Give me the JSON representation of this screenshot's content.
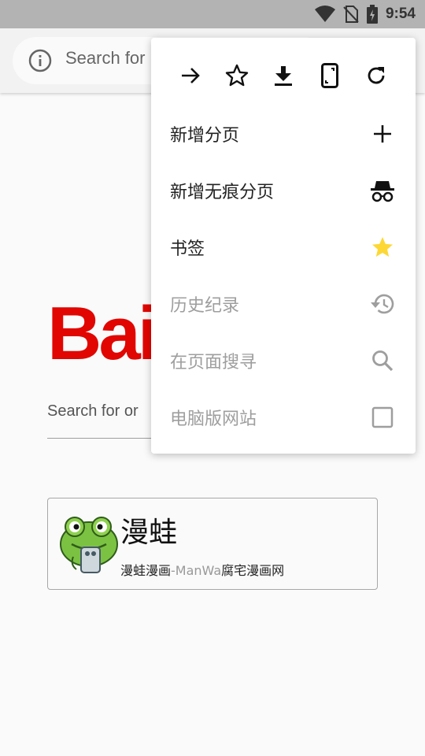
{
  "status_bar": {
    "time": "9:54",
    "icons": [
      "wifi-icon",
      "no-sim-icon",
      "battery-charging-icon"
    ]
  },
  "toolbar": {
    "url_placeholder": "Search for"
  },
  "page": {
    "logo_text": "Bai",
    "search_placeholder": "Search for or"
  },
  "shortcut": {
    "title": "漫蛙",
    "subtitle_a": "漫蛙漫画",
    "subtitle_b": "-ManWa",
    "subtitle_c": "腐宅漫画网"
  },
  "menu": {
    "top_icons": [
      "forward-icon",
      "star-outline-icon",
      "download-icon",
      "phone-icon",
      "refresh-icon"
    ],
    "items": [
      {
        "label": "新增分页",
        "icon": "plus-icon",
        "enabled": true
      },
      {
        "label": "新增无痕分页",
        "icon": "incognito-icon",
        "enabled": true
      },
      {
        "label": "书签",
        "icon": "star-filled-icon",
        "enabled": true
      },
      {
        "label": "历史纪录",
        "icon": "history-icon",
        "enabled": false
      },
      {
        "label": "在页面搜寻",
        "icon": "search-icon",
        "enabled": false
      },
      {
        "label": "电脑版网站",
        "icon": "checkbox-icon",
        "enabled": false
      }
    ]
  },
  "colors": {
    "baidu_red": "#e10601",
    "bookmark_star": "#fdd835",
    "disabled_text": "#9e9e9e"
  }
}
